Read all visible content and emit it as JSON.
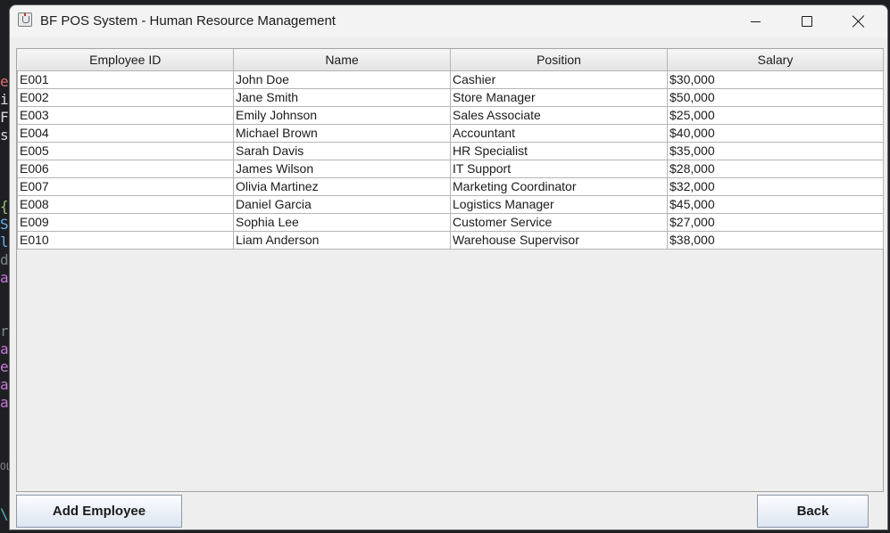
{
  "window": {
    "title": "BF POS System - Human Resource Management",
    "icon": "java-app-icon"
  },
  "background_editor": {
    "glyphs": [
      "e",
      "i",
      "F",
      "s",
      "{",
      "S",
      "l",
      "d",
      "a",
      "r",
      "a",
      "e",
      "a",
      "a",
      "OL",
      "\\l"
    ],
    "colors": [
      "#e06c75",
      "#d7dae0",
      "#d7dae0",
      "#d7dae0",
      "#98c379",
      "#61afef",
      "#61afef",
      "#7f848e",
      "#c678dd",
      "#7f848e",
      "#c678dd",
      "#c678dd",
      "#c678dd",
      "#c678dd",
      "#7f848e",
      "#56b6c2"
    ]
  },
  "table": {
    "columns": [
      "Employee ID",
      "Name",
      "Position",
      "Salary"
    ],
    "rows": [
      [
        "E001",
        "John Doe",
        "Cashier",
        "$30,000"
      ],
      [
        "E002",
        "Jane Smith",
        "Store Manager",
        "$50,000"
      ],
      [
        "E003",
        "Emily Johnson",
        "Sales Associate",
        "$25,000"
      ],
      [
        "E004",
        "Michael Brown",
        "Accountant",
        "$40,000"
      ],
      [
        "E005",
        "Sarah Davis",
        "HR Specialist",
        "$35,000"
      ],
      [
        "E006",
        "James Wilson",
        "IT Support",
        "$28,000"
      ],
      [
        "E007",
        "Olivia Martinez",
        "Marketing Coordinator",
        "$32,000"
      ],
      [
        "E008",
        "Daniel Garcia",
        "Logistics Manager",
        "$45,000"
      ],
      [
        "E009",
        "Sophia Lee",
        "Customer Service",
        "$27,000"
      ],
      [
        "E010",
        "Liam Anderson",
        "Warehouse Supervisor",
        "$38,000"
      ]
    ]
  },
  "buttons": {
    "add_employee": "Add Employee",
    "back": "Back"
  }
}
